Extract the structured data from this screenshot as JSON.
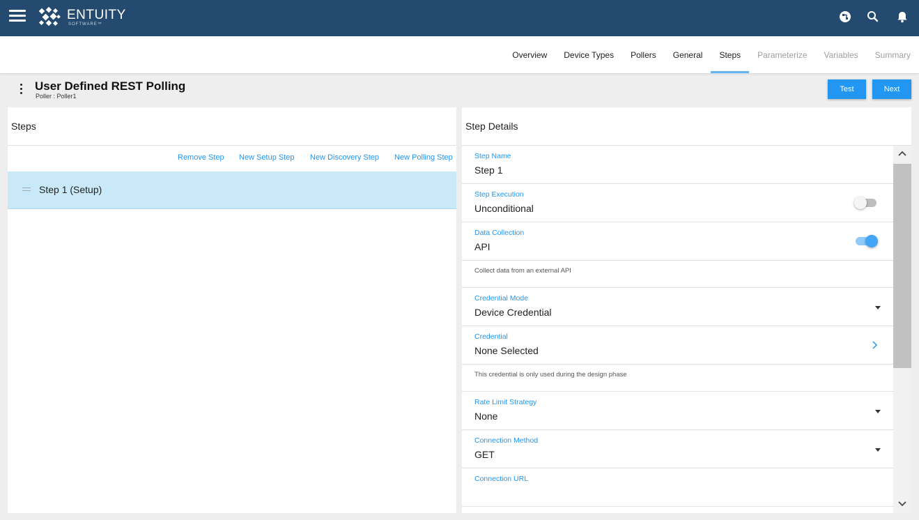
{
  "app": {
    "logo_text": "ENTUITY",
    "logo_sub": "SOFTWARE™"
  },
  "tabs": [
    {
      "label": "Overview",
      "state": "normal"
    },
    {
      "label": "Device Types",
      "state": "normal"
    },
    {
      "label": "Pollers",
      "state": "normal"
    },
    {
      "label": "General",
      "state": "normal"
    },
    {
      "label": "Steps",
      "state": "active"
    },
    {
      "label": "Parameterize",
      "state": "disabled"
    },
    {
      "label": "Variables",
      "state": "disabled"
    },
    {
      "label": "Summary",
      "state": "disabled"
    }
  ],
  "page": {
    "title": "User Defined REST Polling",
    "subtitle": "Poller : Poller1",
    "test_label": "Test",
    "next_label": "Next"
  },
  "steps_panel": {
    "title": "Steps",
    "actions": {
      "remove": "Remove Step",
      "new_setup": "New Setup Step",
      "new_discovery": "New Discovery Step",
      "new_polling": "New Polling Step"
    },
    "items": [
      {
        "label": "Step 1 (Setup)",
        "selected": true
      }
    ]
  },
  "details_panel": {
    "title": "Step Details",
    "step_name": {
      "label": "Step Name",
      "value": "Step 1"
    },
    "step_execution": {
      "label": "Step Execution",
      "value": "Unconditional",
      "toggle": false
    },
    "data_collection": {
      "label": "Data Collection",
      "value": "API",
      "toggle": true
    },
    "data_collection_hint": "Collect data from an external API",
    "credential_mode": {
      "label": "Credential Mode",
      "value": "Device Credential"
    },
    "credential": {
      "label": "Credential",
      "value": "None Selected"
    },
    "credential_hint": "This credential is only used during the design phase",
    "rate_limit": {
      "label": "Rate Limit Strategy",
      "value": "None"
    },
    "connection_method": {
      "label": "Connection Method",
      "value": "GET"
    },
    "connection_url": {
      "label": "Connection URL",
      "value": ""
    }
  },
  "colors": {
    "topbar": "#244b6f",
    "accent": "#2196f3",
    "selected_row": "#c9e9f9"
  }
}
